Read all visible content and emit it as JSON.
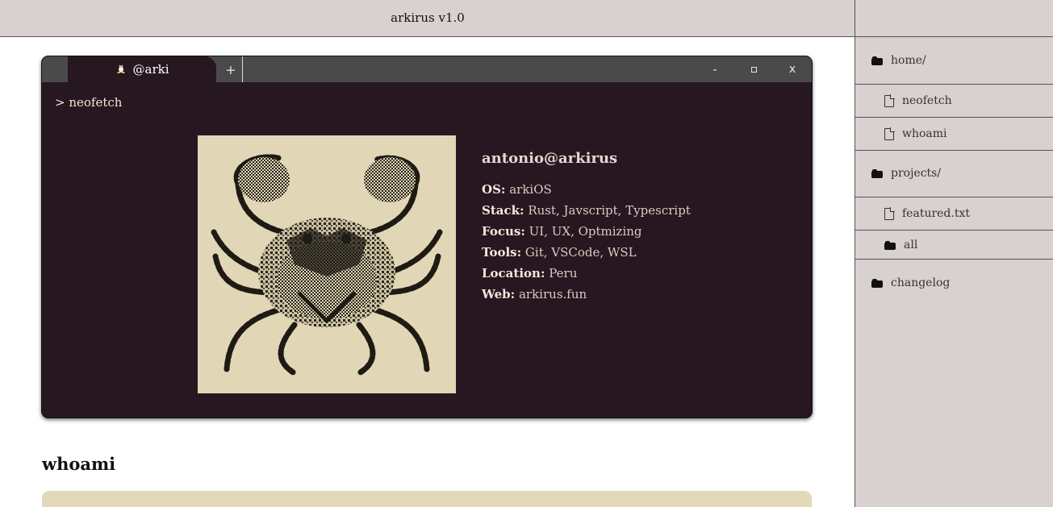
{
  "app": {
    "title": "arkirus v1.0"
  },
  "terminal": {
    "tab_label": "@arki",
    "tab_icon": "tux-icon",
    "add_tab": "+",
    "minimize": "-",
    "close": "x",
    "prompt": "> neofetch"
  },
  "neofetch": {
    "user": "antonio@arkirus",
    "fields": [
      {
        "key": "OS:",
        "value": "arkiOS"
      },
      {
        "key": "Stack:",
        "value": "Rust, Javscript, Typescript"
      },
      {
        "key": "Focus:",
        "value": "UI, UX, Optmizing"
      },
      {
        "key": "Tools:",
        "value": "Git, VSCode, WSL"
      },
      {
        "key": "Location:",
        "value": "Peru"
      },
      {
        "key": "Web:",
        "value": "arkirus.fun"
      }
    ]
  },
  "main": {
    "section_title": "whoami"
  },
  "sidebar": {
    "items": [
      {
        "label": "home/",
        "type": "folder"
      },
      {
        "label": "neofetch",
        "type": "file"
      },
      {
        "label": "whoami",
        "type": "file"
      },
      {
        "label": "projects/",
        "type": "folder"
      },
      {
        "label": "featured.txt",
        "type": "file"
      },
      {
        "label": "all",
        "type": "folder"
      },
      {
        "label": "changelog",
        "type": "folder"
      }
    ]
  },
  "colors": {
    "header_bg": "#d9d0d0",
    "terminal_bg": "#271720",
    "terminal_bar": "#4a4a4a",
    "image_bg": "#e1d7b6"
  }
}
